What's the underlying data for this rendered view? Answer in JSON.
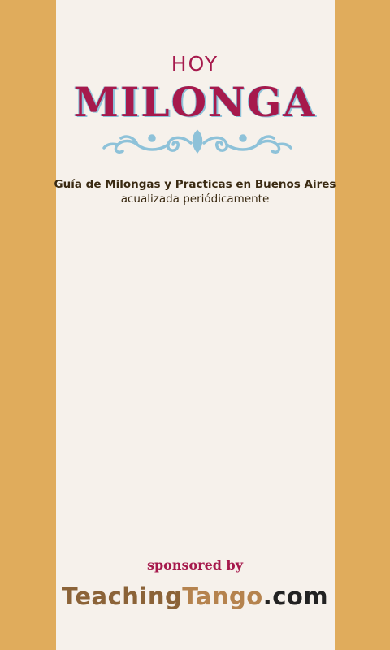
{
  "colors": {
    "background": "#E0AC5C",
    "panel": "#F6F1EB",
    "accent": "#A6194C",
    "ornament": "#8EC2D9",
    "text": "#3A2A12"
  },
  "logo": {
    "top_text": "HOY",
    "title": "MILONGA",
    "ornament_icon": "scroll-ornament-icon"
  },
  "tagline": {
    "line1": "Guía de Milongas y Practicas en Buenos Aires",
    "line2": "acualizada periódicamente"
  },
  "sponsor": {
    "label": "sponsored by",
    "brand_part1": "Teaching",
    "brand_part2": "Tango",
    "brand_part3": ".com"
  }
}
